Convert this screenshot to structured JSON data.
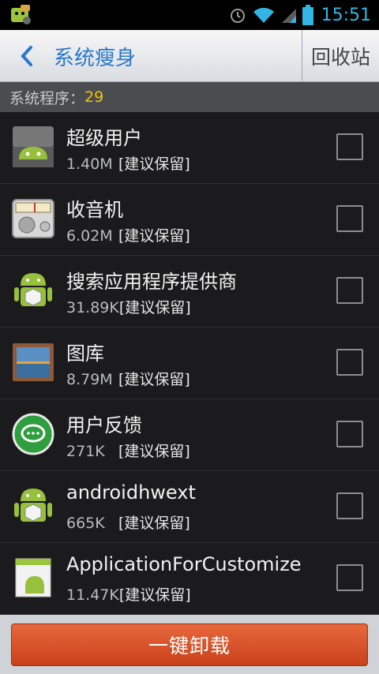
{
  "status_bar": {
    "time": "15:51"
  },
  "header": {
    "title": "系统瘦身",
    "recycle_label": "回收站"
  },
  "section": {
    "label": "系统程序：",
    "count": "29"
  },
  "apps": [
    {
      "name": "超级用户",
      "size": "1.40M",
      "tag": "[建议保留]",
      "icon": "superuser-icon"
    },
    {
      "name": "收音机",
      "size": "6.02M",
      "tag": "[建议保留]",
      "icon": "radio-icon"
    },
    {
      "name": "搜索应用程序提供商",
      "size": "31.89K",
      "tag": "[建议保留]",
      "icon": "android-package-icon"
    },
    {
      "name": "图库",
      "size": "8.79M",
      "tag": "[建议保留]",
      "icon": "gallery-icon"
    },
    {
      "name": "用户反馈",
      "size": "271K",
      "tag": "[建议保留]",
      "icon": "feedback-icon"
    },
    {
      "name": "androidhwext",
      "size": "665K",
      "tag": "[建议保留]",
      "icon": "android-package-icon"
    },
    {
      "name": "ApplicationForCustomize",
      "size": "11.47K",
      "tag": "[建议保留]",
      "icon": "android-document-icon"
    }
  ],
  "bottom": {
    "uninstall_label": "一键卸载"
  },
  "colors": {
    "accent": "#32b5e5",
    "title": "#2a78cf",
    "count": "#f5c200",
    "button": "#d9542a"
  }
}
